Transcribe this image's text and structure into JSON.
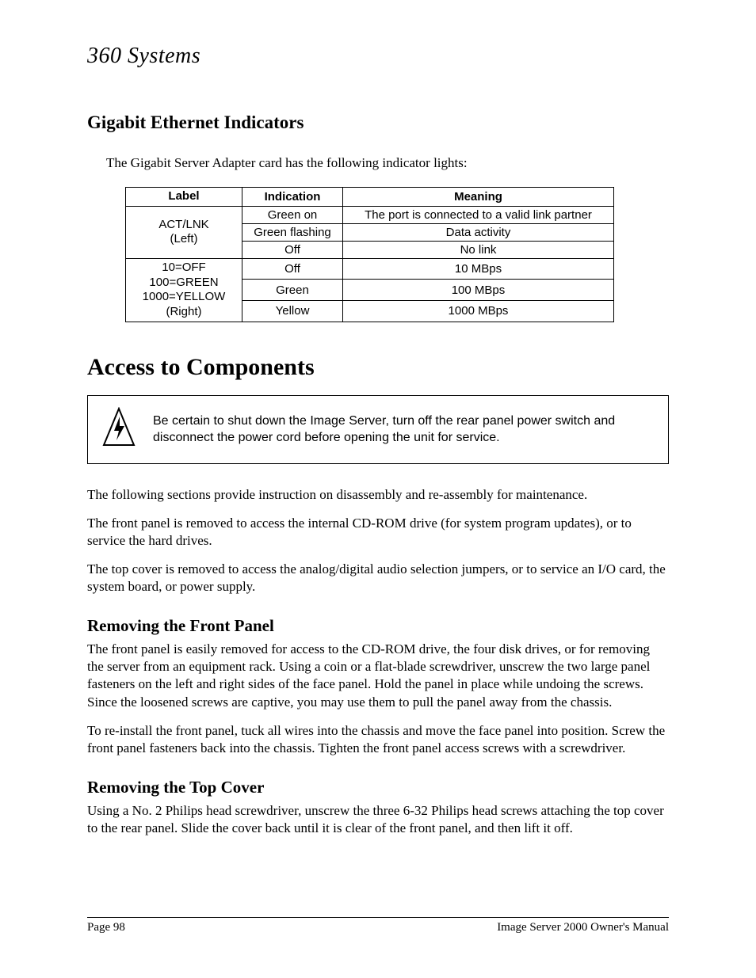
{
  "logo": "360 Systems",
  "section1": {
    "heading": "Gigabit Ethernet Indicators",
    "intro": "The Gigabit Server Adapter card has the following indicator lights:",
    "table": {
      "headers": {
        "c1": "Label",
        "c2": "Indication",
        "c3": "Meaning"
      },
      "group1_label_l1": "ACT/LNK",
      "group1_label_l2": "(Left)",
      "g1r1_ind": "Green on",
      "g1r1_mean": "The port is connected to a valid link partner",
      "g1r2_ind": "Green flashing",
      "g1r2_mean": "Data activity",
      "g1r3_ind": "Off",
      "g1r3_mean": "No link",
      "group2_label_l1": "10=OFF",
      "group2_label_l2": "100=GREEN",
      "group2_label_l3": "1000=YELLOW",
      "group2_label_l4": "(Right)",
      "g2r1_ind": "Off",
      "g2r1_mean": "10 MBps",
      "g2r2_ind": "Green",
      "g2r2_mean": "100 MBps",
      "g2r3_ind": "Yellow",
      "g2r3_mean": "1000 MBps"
    }
  },
  "chapter": {
    "heading": "Access to Components",
    "warning": "Be certain to shut down the Image Server, turn off the rear panel power switch and disconnect the power cord before opening the unit for service.",
    "p1": "The following sections provide instruction on disassembly and re-assembly for maintenance.",
    "p2": "The front panel is removed to access the internal CD-ROM drive (for system program updates), or to service the hard drives.",
    "p3": "The top cover is removed to access the analog/digital audio selection jumpers, or to service an I/O card, the system board, or power supply."
  },
  "sub1": {
    "heading": "Removing the Front Panel",
    "p1": "The front panel is easily removed for access to the CD-ROM drive, the four disk drives, or for removing the server from an equipment rack.  Using a coin or a flat-blade screwdriver, unscrew the two large panel fasteners on the left and right sides of the face panel.  Hold the panel in place while undoing the screws.  Since the loosened screws are captive, you may use them to pull the panel away from the chassis.",
    "p2": "To re-install the front panel, tuck all wires into the chassis and move the face panel into position.  Screw the front panel fasteners back into the chassis.  Tighten the front panel access screws with a screwdriver."
  },
  "sub2": {
    "heading": "Removing the Top Cover",
    "p1": "Using a No. 2 Philips head screwdriver, unscrew the three 6-32 Philips head screws attaching the top cover to the rear panel.  Slide the cover back until it is clear of the front panel, and then lift it off."
  },
  "footer": {
    "left": "Page 98",
    "right": "Image Server 2000 Owner's Manual"
  }
}
